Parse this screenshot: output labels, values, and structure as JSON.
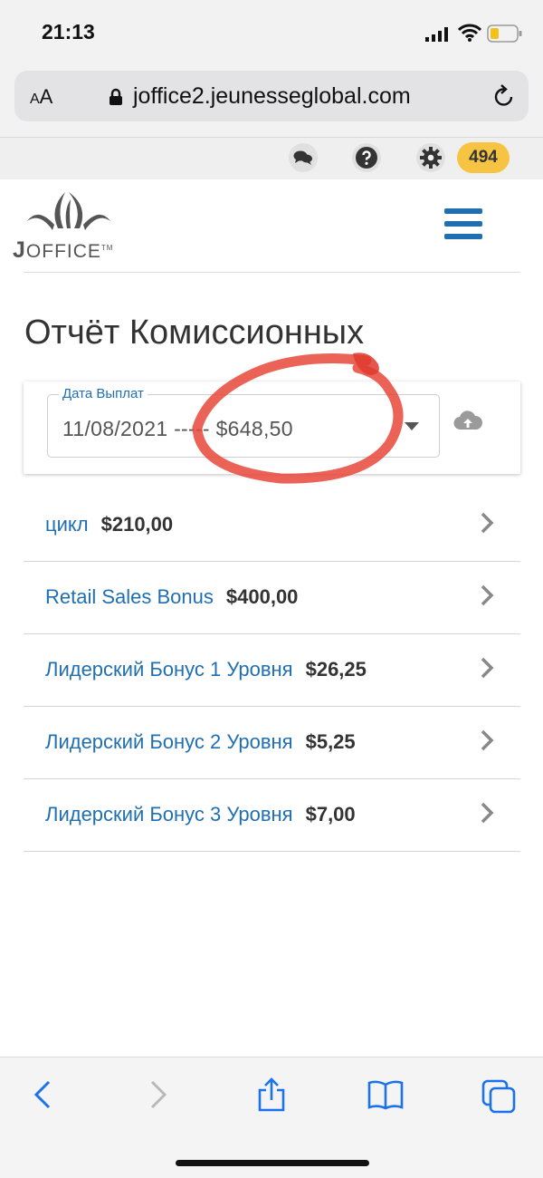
{
  "status_bar": {
    "time": "21:13"
  },
  "browser": {
    "text_size_label": "AA",
    "url": "joffice2.jeunesseglobal.com"
  },
  "toolbar": {
    "badge_count": "494",
    "icons": [
      "chat-icon",
      "help-icon",
      "gear-icon"
    ]
  },
  "header": {
    "logo_text_first": "J",
    "logo_text_rest": "OFFICE",
    "logo_tm": "TM"
  },
  "page": {
    "title": "Отчёт Комиссионных",
    "date_field": {
      "label": "Дата Выплат",
      "value": "11/08/2021 ----- $648,50"
    }
  },
  "commissions": [
    {
      "label": "цикл",
      "amount": "$210,00"
    },
    {
      "label": "Retail Sales Bonus",
      "amount": "$400,00"
    },
    {
      "label": "Лидерский Бонус 1 Уровня",
      "amount": "$26,25"
    },
    {
      "label": "Лидерский Бонус 2 Уровня",
      "amount": "$5,25"
    },
    {
      "label": "Лидерский Бонус 3 Уровня",
      "amount": "$7,00"
    }
  ],
  "colors": {
    "link": "#1f6fb2",
    "badge": "#f6c343",
    "annotation": "#e8463a"
  }
}
